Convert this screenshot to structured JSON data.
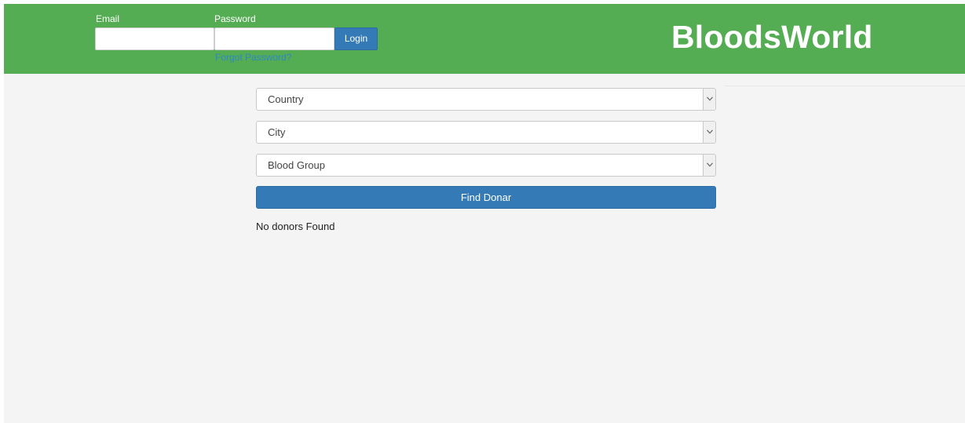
{
  "header": {
    "email_label": "Email",
    "email_value": "",
    "password_label": "Password",
    "password_value": "",
    "login_label": "Login",
    "forgot_password_label": "Forgot Password?",
    "brand_title": "BloodsWorld"
  },
  "search": {
    "country": {
      "selected": "Country"
    },
    "city": {
      "selected": "City"
    },
    "blood_group": {
      "selected": "Blood Group"
    },
    "find_button_label": "Find Donar",
    "result_text": "No donors Found"
  },
  "icons": {
    "dropdown_arrow": "chevron-down-icon"
  },
  "colors": {
    "header_bg": "#55ad53",
    "page_bg": "#f4f4f4",
    "primary_button": "#337ab7",
    "link": "#2e86c9"
  }
}
